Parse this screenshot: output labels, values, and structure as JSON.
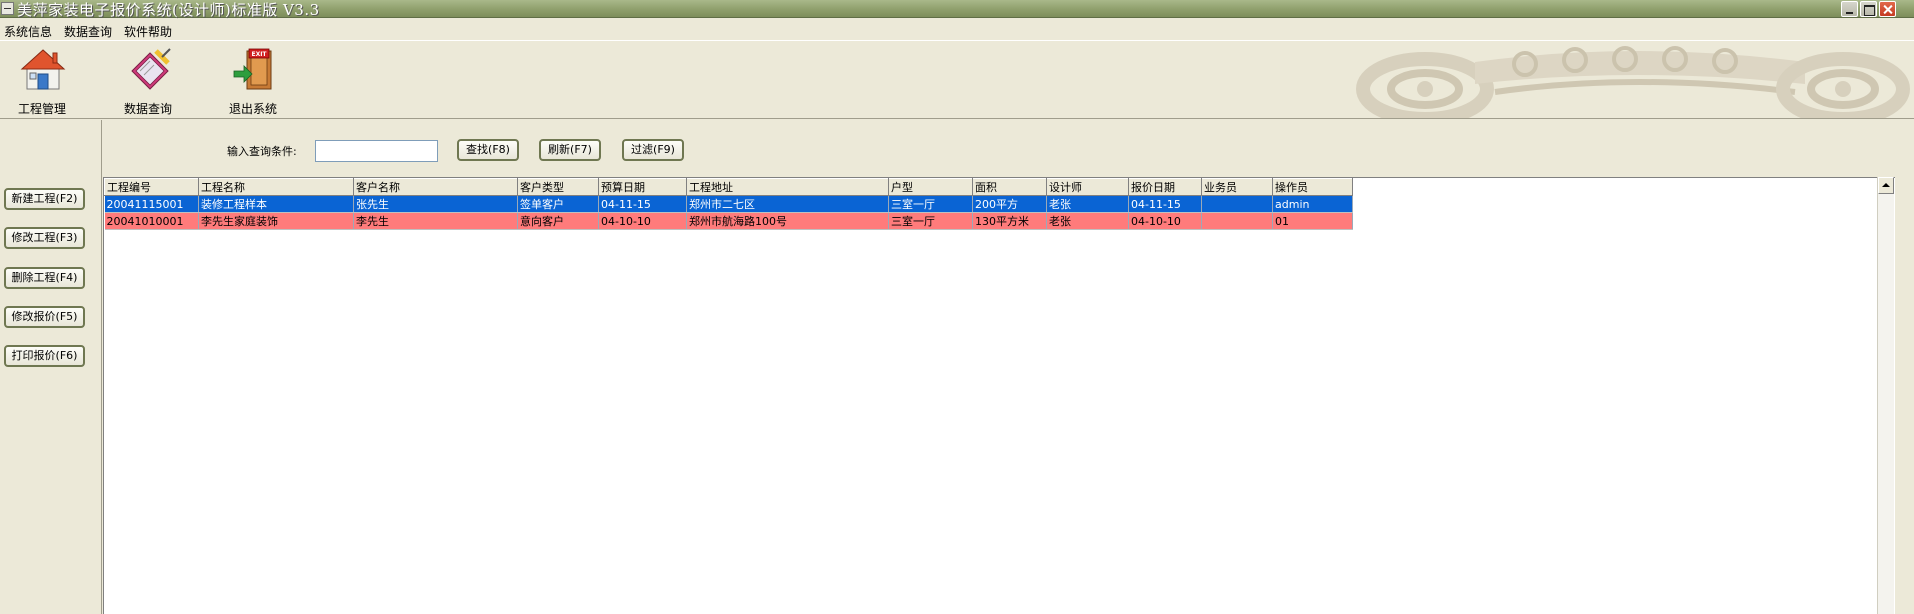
{
  "window": {
    "title": "美萍家装电子报价系统(设计师)标准版 V3.3"
  },
  "menu": [
    "系统信息",
    "数据查询",
    "软件帮助"
  ],
  "toolbar": {
    "project": "工程管理",
    "query": "数据查询",
    "exit": "退出系统"
  },
  "side_buttons": [
    "新建工程(F2)",
    "修改工程(F3)",
    "删除工程(F4)",
    "修改报价(F5)",
    "打印报价(F6)"
  ],
  "search": {
    "label": "输入查询条件:",
    "value": "",
    "find": "查找(F8)",
    "refresh": "刷新(F7)",
    "filter": "过滤(F9)"
  },
  "table": {
    "columns": [
      "工程编号",
      "工程名称",
      "客户名称",
      "客户类型",
      "预算日期",
      "工程地址",
      "户型",
      "面积",
      "设计师",
      "报价日期",
      "业务员",
      "操作员"
    ],
    "rows": [
      [
        "20041115001",
        "装修工程样本",
        "张先生",
        "签单客户",
        "04-11-15",
        "郑州市二七区",
        "三室一厅",
        "200平方",
        "老张",
        "04-11-15",
        "",
        "admin"
      ],
      [
        "20041010001",
        "李先生家庭装饰",
        "李先生",
        "意向客户",
        "04-10-10",
        "郑州市航海路100号",
        "三室一厅",
        "130平方米",
        "老张",
        "04-10-10",
        "",
        "01"
      ]
    ],
    "selected_row_color": "#0a64d4",
    "highlight_row_color": "#ff7b7b"
  },
  "icons": {
    "house": "house-icon",
    "search": "search-icon",
    "exit": "exit-icon"
  }
}
